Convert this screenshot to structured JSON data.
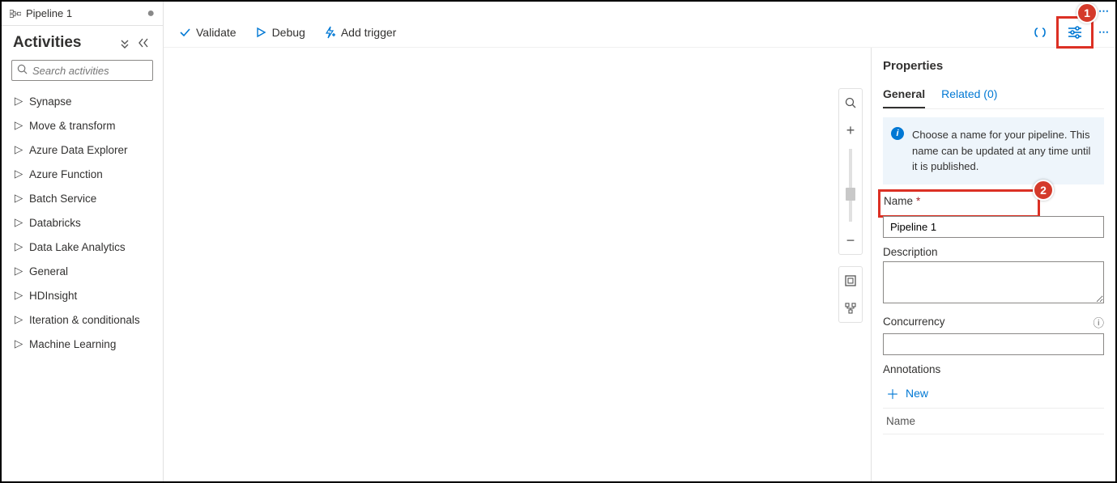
{
  "tab": {
    "title": "Pipeline 1"
  },
  "sidebar": {
    "header": "Activities",
    "search_placeholder": "Search activities",
    "items": [
      {
        "label": "Synapse"
      },
      {
        "label": "Move & transform"
      },
      {
        "label": "Azure Data Explorer"
      },
      {
        "label": "Azure Function"
      },
      {
        "label": "Batch Service"
      },
      {
        "label": "Databricks"
      },
      {
        "label": "Data Lake Analytics"
      },
      {
        "label": "General"
      },
      {
        "label": "HDInsight"
      },
      {
        "label": "Iteration & conditionals"
      },
      {
        "label": "Machine Learning"
      }
    ]
  },
  "toolbar": {
    "validate": "Validate",
    "debug": "Debug",
    "add_trigger": "Add trigger"
  },
  "properties": {
    "title": "Properties",
    "tabs": {
      "general": "General",
      "related": "Related (0)"
    },
    "info": "Choose a name for your pipeline. This name can be updated at any time until it is published.",
    "name_label": "Name",
    "name_value": "Pipeline 1",
    "description_label": "Description",
    "description_value": "",
    "concurrency_label": "Concurrency",
    "concurrency_value": "",
    "annotations_label": "Annotations",
    "add_new": "New",
    "ann_col": "Name"
  },
  "callouts": {
    "one": "1",
    "two": "2"
  }
}
